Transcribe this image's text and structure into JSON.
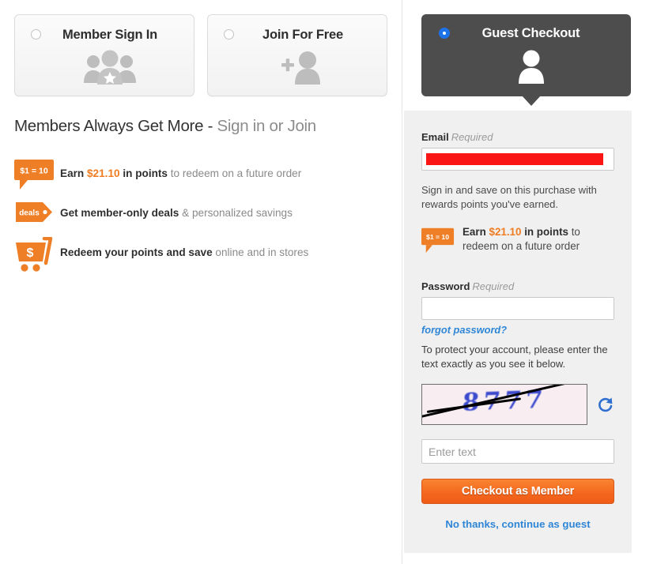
{
  "tabs": [
    {
      "id": "member-sign-in",
      "label": "Member Sign In",
      "icon": "members-group-star-icon",
      "selected": false
    },
    {
      "id": "join-for-free",
      "label": "Join For Free",
      "icon": "add-person-icon",
      "selected": false
    },
    {
      "id": "guest-checkout",
      "label": "Guest Checkout",
      "icon": "person-icon",
      "selected": true
    }
  ],
  "promo": {
    "heading_strong": "Members Always Get More -",
    "heading_muted": " Sign in or Join",
    "benefits": [
      {
        "icon": "points-ratio-badge-icon",
        "badge_text": "$1 = 10",
        "bold_prefix": "Earn ",
        "amount": "$21.10",
        "bold_suffix": " in points",
        "tail": " to redeem on a future order"
      },
      {
        "icon": "deals-tag-icon",
        "badge_text": "deals",
        "bold_prefix": "Get member-only deals",
        "amount": "",
        "bold_suffix": "",
        "tail": " & personalized savings"
      },
      {
        "icon": "shopping-cart-dollar-icon",
        "badge_text": "$",
        "bold_prefix": "Redeem your points and save",
        "amount": "",
        "bold_suffix": "",
        "tail": " online and in stores"
      }
    ]
  },
  "form": {
    "email": {
      "label": "Email",
      "required_note": "Required",
      "value": "",
      "redacted": true
    },
    "helper_text": "Sign in and save on this purchase with rewards points you've earned.",
    "panel_benefit": {
      "icon": "points-ratio-badge-icon",
      "badge_text": "$1 = 10",
      "bold_prefix": "Earn ",
      "amount": "$21.10",
      "bold_suffix": " in points",
      "tail": " to redeem on a future order"
    },
    "password": {
      "label": "Password",
      "required_note": "Required",
      "value": ""
    },
    "forgot_password_label": "forgot password?",
    "captcha": {
      "instructions": "To protect your account, please enter the text exactly as you see it below.",
      "image_text": "8777",
      "refresh_icon": "refresh-icon",
      "input_placeholder": "Enter text",
      "input_value": ""
    },
    "submit_label": "Checkout as Member",
    "guest_link_label": "No thanks, continue as guest"
  },
  "colors": {
    "accent_orange": "#f07c22",
    "link_blue": "#2f86d6",
    "radio_blue": "#1e72e8",
    "guest_tab_bg": "#4d4d4d",
    "panel_bg": "#f0f0f0",
    "redaction_red": "#fb1616",
    "captcha_blue": "#2c3ccb"
  }
}
